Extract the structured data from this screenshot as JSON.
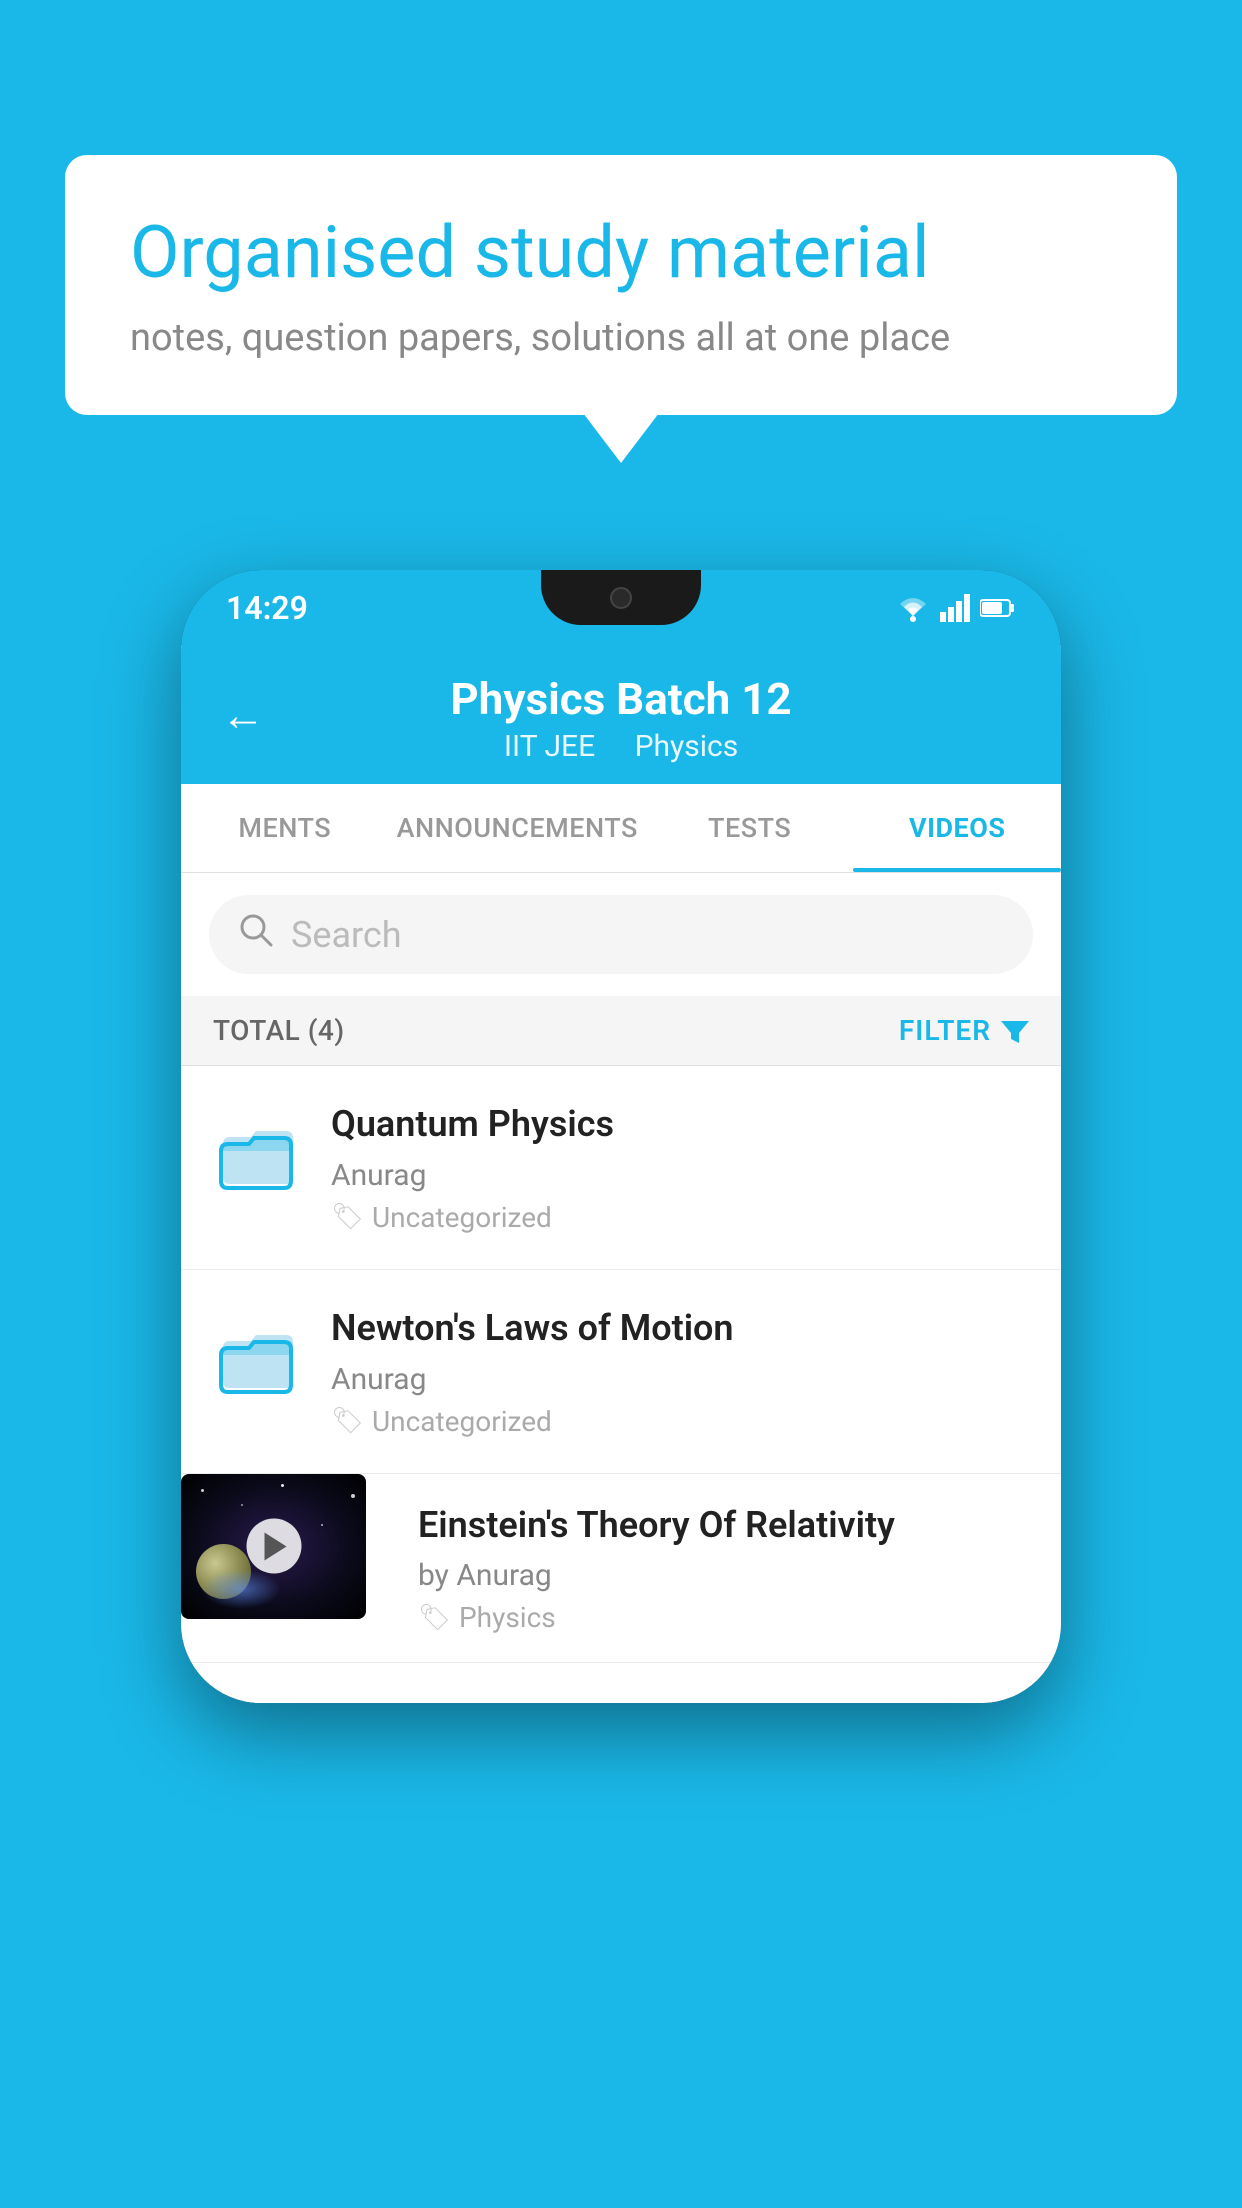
{
  "background_color": "#1ab8e8",
  "speech_bubble": {
    "title": "Organised study material",
    "subtitle": "notes, question papers, solutions all at one place"
  },
  "phone": {
    "status_bar": {
      "time": "14:29",
      "icons": [
        "wifi",
        "signal",
        "battery"
      ]
    },
    "header": {
      "title": "Physics Batch 12",
      "subtitle_part1": "IIT JEE",
      "subtitle_part2": "Physics",
      "back_label": "←"
    },
    "tabs": [
      {
        "label": "MENTS",
        "active": false
      },
      {
        "label": "ANNOUNCEMENTS",
        "active": false
      },
      {
        "label": "TESTS",
        "active": false
      },
      {
        "label": "VIDEOS",
        "active": true
      }
    ],
    "search": {
      "placeholder": "Search"
    },
    "filter_bar": {
      "total_label": "TOTAL (4)",
      "filter_label": "FILTER"
    },
    "videos": [
      {
        "id": 1,
        "title": "Quantum Physics",
        "author": "Anurag",
        "tag": "Uncategorized",
        "has_thumbnail": false
      },
      {
        "id": 2,
        "title": "Newton's Laws of Motion",
        "author": "Anurag",
        "tag": "Uncategorized",
        "has_thumbnail": false
      },
      {
        "id": 3,
        "title": "Einstein's Theory Of Relativity",
        "author": "by Anurag",
        "tag": "Physics",
        "has_thumbnail": true
      }
    ]
  }
}
